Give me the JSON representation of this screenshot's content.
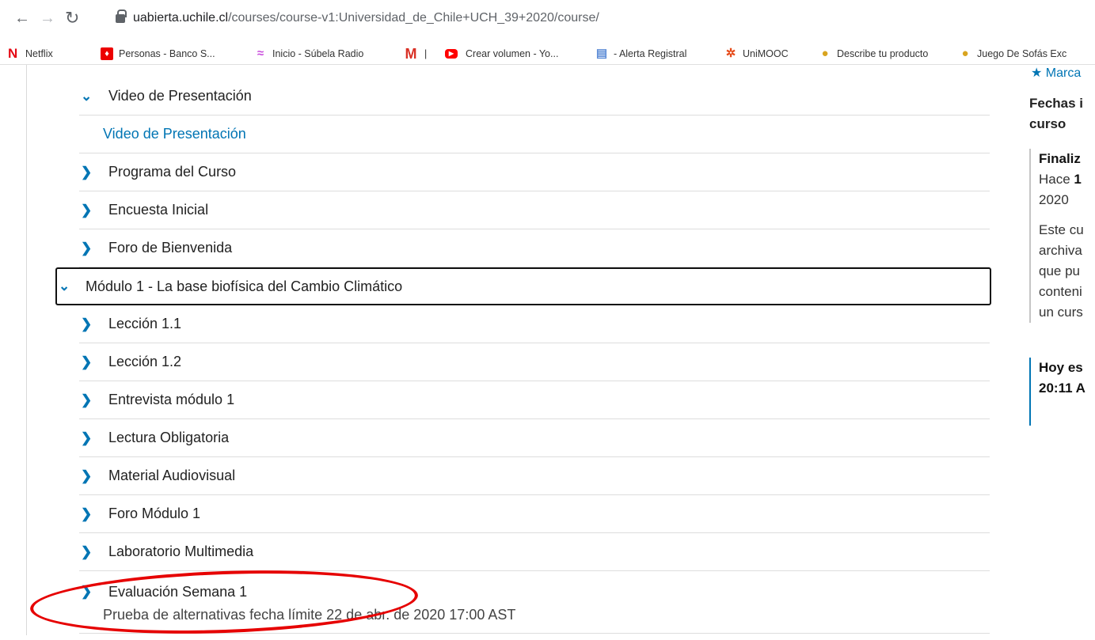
{
  "browser": {
    "url_host": "uabierta.uchile.cl",
    "url_path": "/courses/course-v1:Universidad_de_Chile+UCH_39+2020/course/",
    "bookmarks": [
      {
        "label": "Netflix",
        "icon": "netflix-icon",
        "color": "#e50914"
      },
      {
        "label": "Personas - Banco S...",
        "icon": "bank-icon",
        "color": "#ec0000"
      },
      {
        "label": "Inicio - Súbela Radio",
        "icon": "radio-icon",
        "color": "#c94ddc"
      },
      {
        "label": "|",
        "icon": "gmail-icon",
        "color": "#d93025"
      },
      {
        "label": "Crear volumen - Yo...",
        "icon": "youtube-icon",
        "color": "#ff0000"
      },
      {
        "label": "- Alerta Registral",
        "icon": "document-icon",
        "color": "#5b8bd6"
      },
      {
        "label": "UniMOOC",
        "icon": "unimooc-icon",
        "color": "#e64a19"
      },
      {
        "label": "Describe tu producto",
        "icon": "cookie-icon",
        "color": "#d9a520"
      },
      {
        "label": "Juego De Sofás Exc",
        "icon": "cookie-icon",
        "color": "#d9a520"
      }
    ]
  },
  "outline": {
    "section_video": "Video de Presentación",
    "video_link": "Video de Presentación",
    "items_intro": [
      "Programa del Curso",
      "Encuesta Inicial",
      "Foro de Bienvenida"
    ],
    "module_title": "Módulo 1 - La base biofísica del Cambio Climático",
    "module_items": [
      "Lección 1.1",
      "Lección 1.2",
      "Entrevista módulo 1",
      "Lectura Obligatoria",
      "Material Audiovisual",
      "Foro Módulo 1",
      "Laboratorio Multimedia"
    ],
    "eval_title": "Evaluación Semana 1",
    "eval_subtitle": "Prueba de alternativas fecha límite 22 de abr. de 2020 17:00 AST"
  },
  "sidebar": {
    "top_link": "Marca",
    "dates_title_1": "Fechas i",
    "dates_title_2": "curso",
    "ended_label": "Finaliz",
    "ended_line_a": "Hace ",
    "ended_line_b": "1",
    "ended_line_c": "2020",
    "archived_lines": [
      "Este cu",
      "archiva",
      "que pu",
      "conteni",
      "un curs"
    ],
    "today_line1": "Hoy es",
    "today_line2": "20:11 A"
  }
}
